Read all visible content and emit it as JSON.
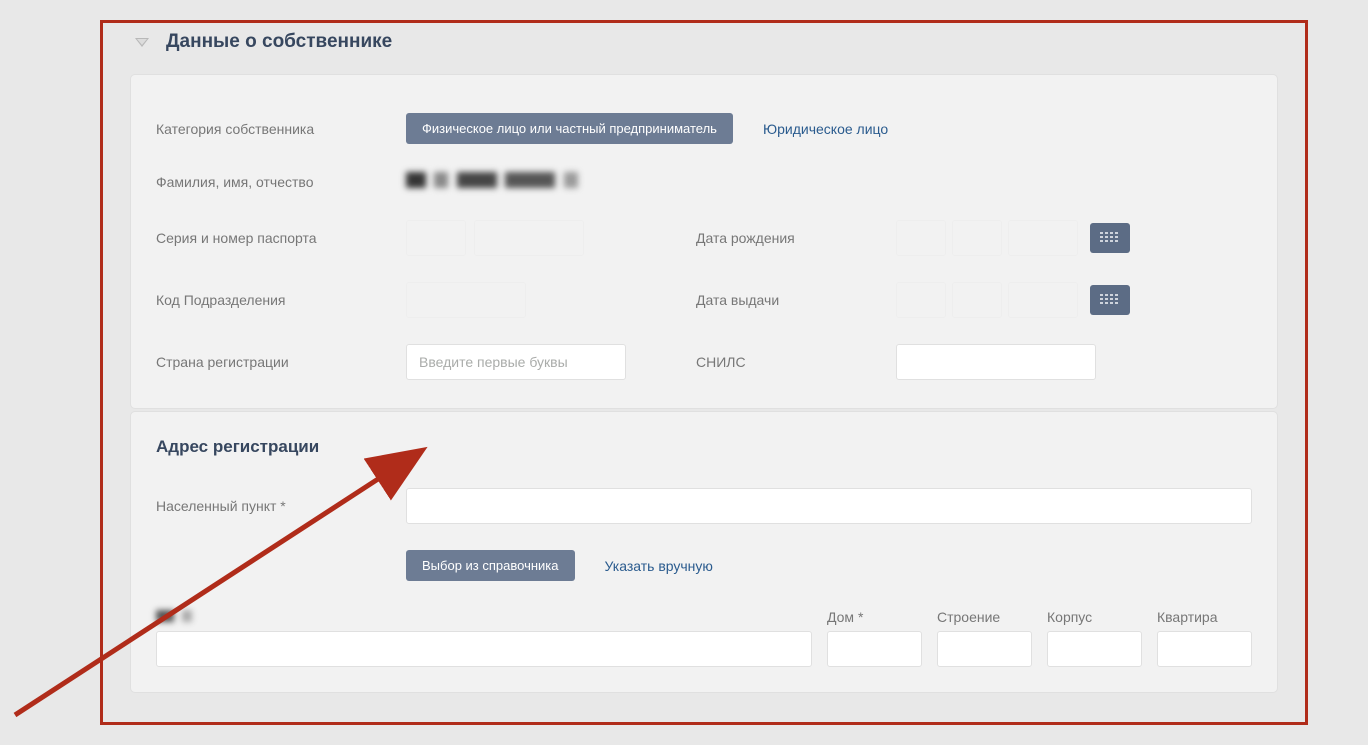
{
  "section": {
    "title": "Данные о собственнике"
  },
  "owner": {
    "category_label": "Категория собственника",
    "category_options": {
      "individual": "Физическое лицо или частный предприниматель",
      "legal": "Юридическое лицо"
    },
    "name_label": "Фамилия, имя, отчество",
    "passport_label": "Серия и номер паспорта",
    "birthdate_label": "Дата рождения",
    "deptcode_label": "Код Подразделения",
    "issuedate_label": "Дата выдачи",
    "country_label": "Страна регистрации",
    "country_placeholder": "Введите первые буквы",
    "snils_label": "СНИЛС"
  },
  "address": {
    "section_title": "Адрес регистрации",
    "settlement_label": "Населенный пункт *",
    "from_ref_btn": "Выбор из справочника",
    "manual_link": "Указать вручную",
    "house_label": "Дом *",
    "building_label": "Строение",
    "corpus_label": "Корпус",
    "apartment_label": "Квартира"
  }
}
